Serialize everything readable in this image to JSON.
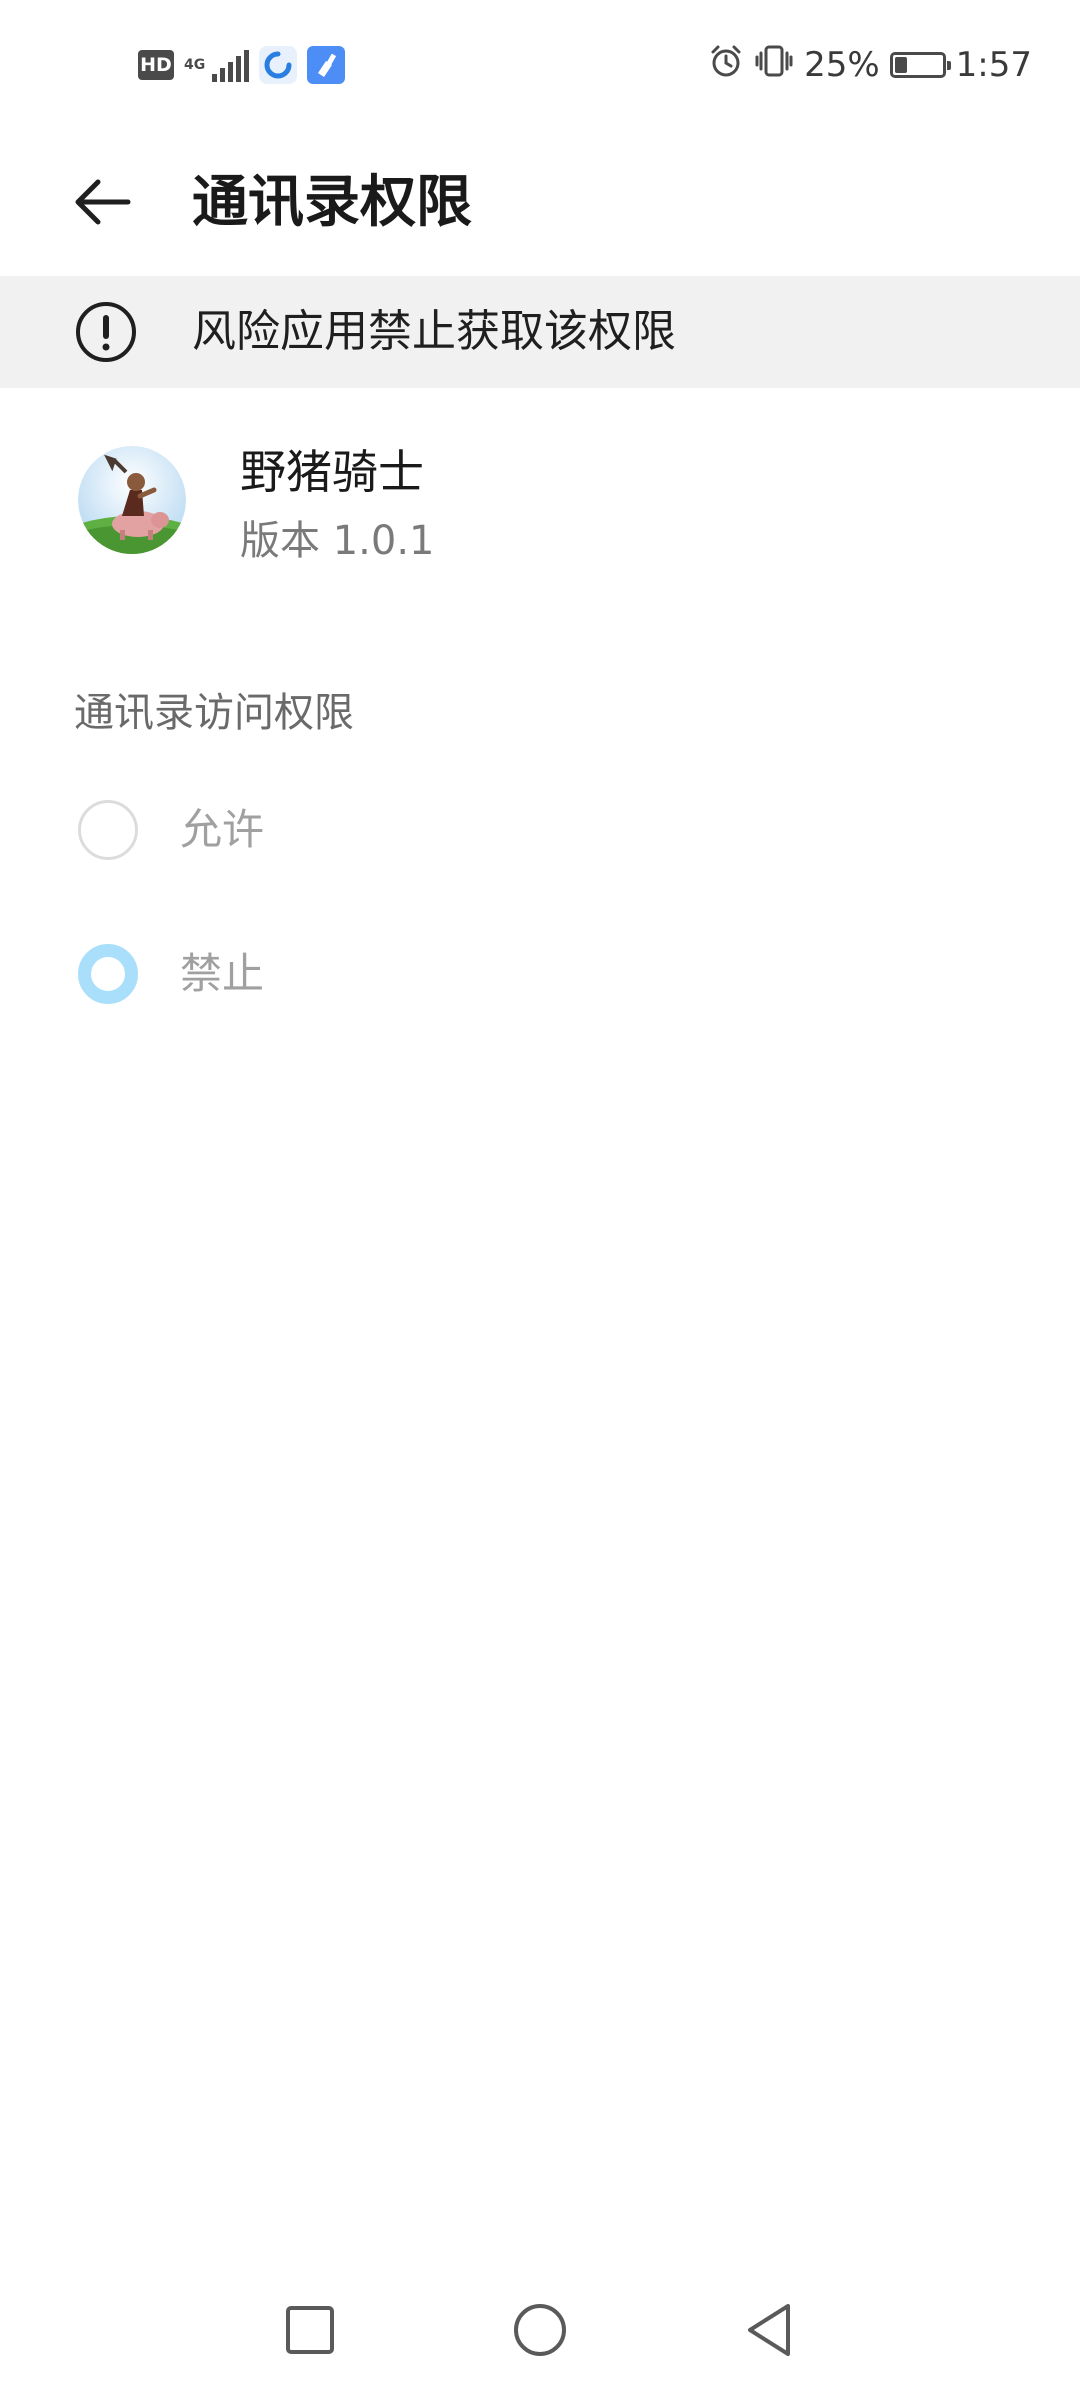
{
  "status_bar": {
    "hd_label": "HD",
    "network_label": "4G",
    "battery_percent_text": "25%",
    "battery_level": 0.25,
    "time": "1:57",
    "icons": [
      "hd-icon",
      "signal-icon",
      "app-notification-icon",
      "cleaner-notification-icon",
      "alarm-icon",
      "vibrate-icon",
      "battery-icon"
    ]
  },
  "header": {
    "title": "通讯录权限",
    "back_icon": "arrow-left-icon"
  },
  "warning": {
    "icon": "exclamation-circle-icon",
    "text": "风险应用禁止获取该权限"
  },
  "app": {
    "name": "野猪骑士",
    "version": "版本 1.0.1"
  },
  "permission": {
    "section_label": "通讯录访问权限",
    "options": [
      {
        "label": "允许",
        "selected": false
      },
      {
        "label": "禁止",
        "selected": true
      }
    ],
    "accent_color": "#a9dffa"
  },
  "nav_bar": {
    "icons": [
      "recent-apps-icon",
      "home-icon",
      "back-icon"
    ]
  }
}
